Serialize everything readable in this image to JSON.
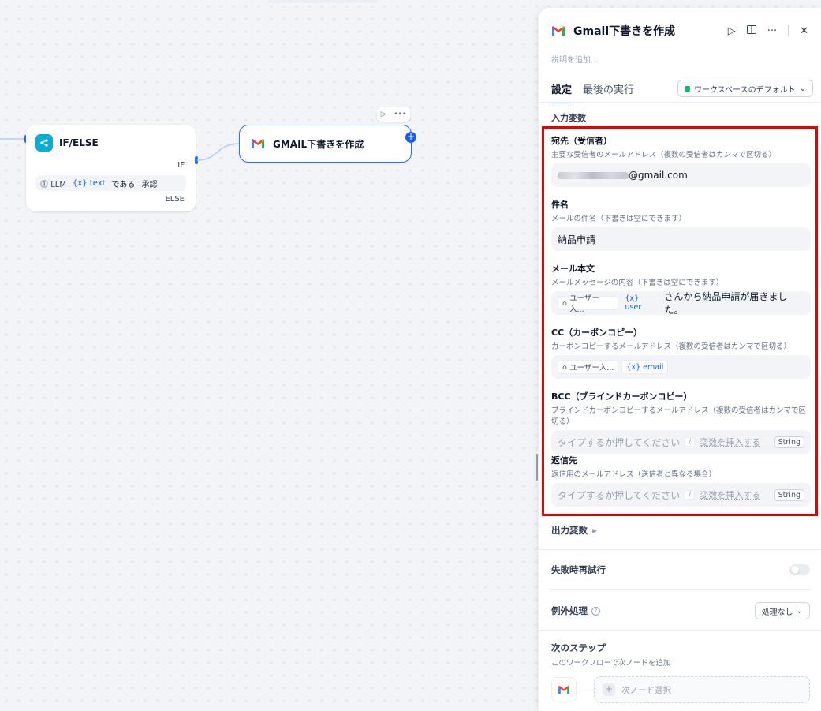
{
  "canvas": {
    "ifelse_node": {
      "title": "IF/ELSE",
      "if_label": "IF",
      "else_label": "ELSE",
      "condition": {
        "source": "LLM",
        "variable": "{x} text",
        "operator": "である",
        "value": "承認"
      }
    },
    "gmail_node": {
      "title": "GMAIL下書きを作成"
    }
  },
  "panel": {
    "title": "Gmail下書きを作成",
    "description_placeholder": "説明を追加...",
    "tabs": [
      "設定",
      "最後の実行"
    ],
    "workspace_select": "ワークスペースのデフォルト",
    "input_section_label": "入力変数",
    "fields": {
      "to": {
        "label": "宛先（受信者）",
        "desc": "主要な受信者のメールアドレス（複数の受信者はカンマで区切る）",
        "value_suffix": "@gmail.com"
      },
      "subject": {
        "label": "件名",
        "desc": "メールの件名（下書きは空にできます）",
        "value": "納品申請"
      },
      "body": {
        "label": "メール本文",
        "desc": "メールメッセージの内容（下書きは空にできます）",
        "chip_node": "ユーザー入...",
        "chip_var": "{x} user",
        "text": "さんから納品申請が届きました。"
      },
      "cc": {
        "label": "CC（カーボンコピー）",
        "desc": "カーボンコピーするメールアドレス（複数の受信者はカンマで区切る）",
        "chip_node": "ユーザー入...",
        "chip_var": "{x} email"
      },
      "bcc": {
        "label": "BCC（ブラインドカーボンコピー）",
        "desc": "ブラインドカーボンコピーするメールアドレス（複数の受信者はカンマで区切る）",
        "placeholder": "タイプするか押してください",
        "slash": "/",
        "insert": "変数を挿入する",
        "type": "String"
      },
      "reply_to": {
        "label": "返信先",
        "desc": "返信用のメールアドレス（送信者と異なる場合）",
        "placeholder": "タイプするか押してください",
        "slash": "/",
        "insert": "変数を挿入する",
        "type": "String"
      }
    },
    "output_label": "出力変数",
    "retry_label": "失敗時再試行",
    "exception_label": "例外処理",
    "exception_select": "処理なし",
    "next_step": {
      "title": "次のステップ",
      "desc": "このワークフローで次ノードを追加",
      "select_label": "次ノード選択"
    }
  },
  "colors": {
    "accent": "#155eef",
    "highlight": "#e60000",
    "gmail_red": "#ea4335"
  }
}
